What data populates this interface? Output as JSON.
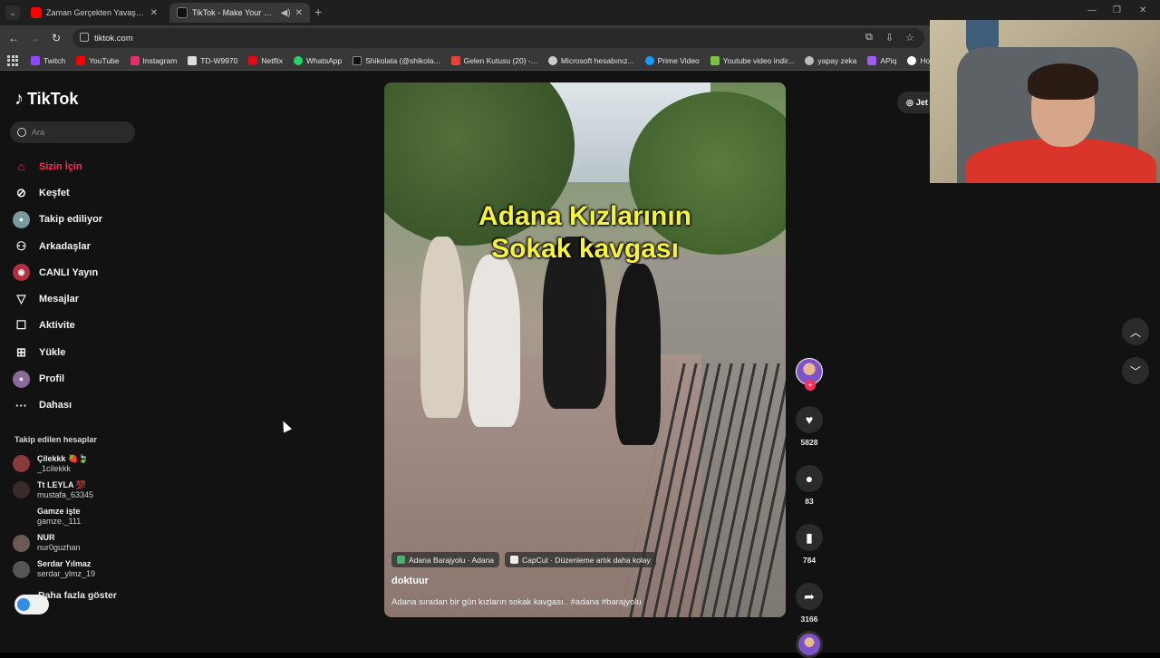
{
  "browser": {
    "tabs": [
      {
        "title": "Zaman Gerçekten Yavaşlayabilir mi?",
        "active": false,
        "favicon_color": "#ff0000"
      },
      {
        "title": "TikTok - Make Your Day",
        "active": true,
        "favicon_color": "#000000"
      }
    ],
    "new_tab_icon": "plus-icon",
    "url": "tiktok.com",
    "bookmarks": [
      {
        "label": "Twitch",
        "color": "#9146ff"
      },
      {
        "label": "YouTube",
        "color": "#ff0000"
      },
      {
        "label": "Instagram",
        "color": "#e1306c"
      },
      {
        "label": "TD-W9970",
        "color": "#dddddd"
      },
      {
        "label": "Netflix",
        "color": "#e50914"
      },
      {
        "label": "WhatsApp",
        "color": "#25d366"
      },
      {
        "label": "Shikolata (@shikola...",
        "color": "#111111"
      },
      {
        "label": "Gelen Kutusu (20) -...",
        "color": "#ea4335"
      },
      {
        "label": "Microsoft hesabınız...",
        "color": "#cccccc"
      },
      {
        "label": "Prime Video",
        "color": "#1399ff"
      },
      {
        "label": "Youtube video indir...",
        "color": "#7cc242"
      },
      {
        "label": "yapay zeka",
        "color": "#bbbbbb"
      },
      {
        "label": "APiq",
        "color": "#a05cf0"
      },
      {
        "label": "Home - Max",
        "color": "#ffffff"
      }
    ]
  },
  "sidebar": {
    "logo": "TikTok",
    "search_placeholder": "Ara",
    "nav": [
      {
        "label": "Sizin İçin",
        "icon": "home-icon",
        "active": true
      },
      {
        "label": "Keşfet",
        "icon": "compass-icon",
        "active": false
      },
      {
        "label": "Takip ediliyor",
        "icon": "following-avatar-icon",
        "active": false
      },
      {
        "label": "Arkadaşlar",
        "icon": "friends-icon",
        "active": false
      },
      {
        "label": "CANLI Yayın",
        "icon": "live-icon",
        "active": false
      },
      {
        "label": "Mesajlar",
        "icon": "paper-plane-icon",
        "active": false
      },
      {
        "label": "Aktivite",
        "icon": "activity-icon",
        "active": false
      },
      {
        "label": "Yükle",
        "icon": "upload-icon",
        "active": false
      },
      {
        "label": "Profil",
        "icon": "profile-avatar-icon",
        "active": false
      },
      {
        "label": "Dahası",
        "icon": "more-dots-icon",
        "active": false
      }
    ],
    "following_title": "Takip edilen hesaplar",
    "following": [
      {
        "name": "Çilekkk 🍓🍃",
        "username": "_1cilekkk",
        "avatar_color": "#8a3a3a"
      },
      {
        "name": "Tt LEYLA 💯",
        "username": "mustafa_63345",
        "avatar_color": "#3a2a2a"
      },
      {
        "name": "Gamze işte",
        "username": "gamze._111",
        "avatar_color": "#121212"
      },
      {
        "name": "NUR",
        "username": "nur0guzhan",
        "avatar_color": "#6b5a52"
      },
      {
        "name": "Serdar Yılmaz",
        "username": "serdar_ylmz_19",
        "avatar_color": "#555555"
      }
    ],
    "show_more": "Daha fazla göster"
  },
  "video": {
    "caption_line1": "Adana Kızlarının",
    "caption_line2": "Sokak kavgası",
    "location_chip": "Adana Barajyolu · Adana",
    "capcut_chip": "CapCut · Düzenleme artık daha kolay",
    "username": "doktuur",
    "description": "Adana sıradan bir gün kızların sokak kavgası.. #adana #barajyolu"
  },
  "actions": {
    "likes": "5828",
    "comments": "83",
    "saves": "784",
    "shares": "3166"
  },
  "top_right_button": "Jet"
}
